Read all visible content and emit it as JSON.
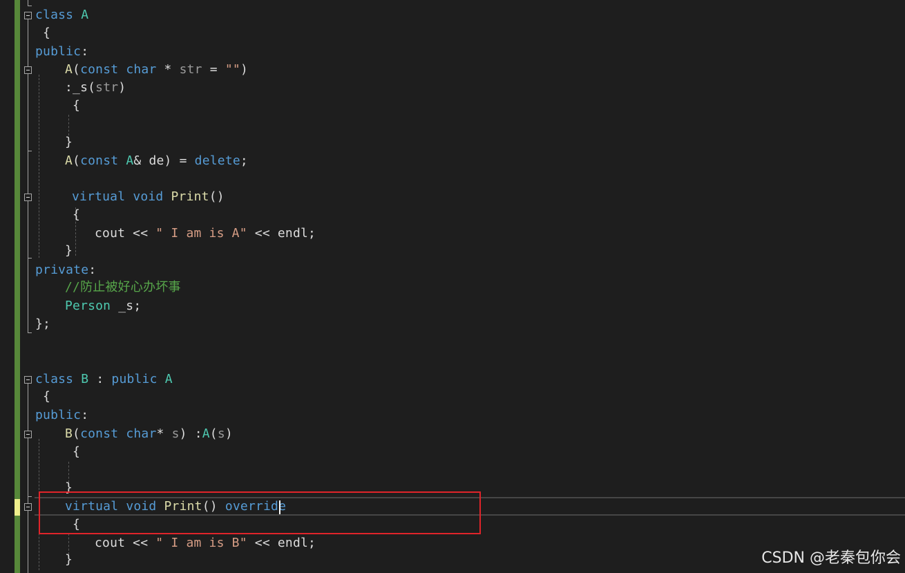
{
  "editor": {
    "lines": {
      "l01": {
        "kw": "class",
        "name": "A"
      },
      "l02": {
        "text": "{"
      },
      "l03": {
        "kw": "public",
        "colon": ":"
      },
      "l04": {
        "fn": "A",
        "p1": "(",
        "kw1": "const",
        "kw2": "char",
        "rest": " * ",
        "param": "str",
        "eq": " = ",
        "str": "\"\"",
        "p2": ")"
      },
      "l05": {
        "colon": ":",
        "member": "_s",
        "p1": "(",
        "param": "str",
        "p2": ")"
      },
      "l06": {
        "text": "{"
      },
      "l07": {
        "text": "}"
      },
      "l08": {
        "fn": "A",
        "p1": "(",
        "kw1": "const",
        "type": "A",
        "rest": "& de) = ",
        "kw2": "delete",
        "semi": ";"
      },
      "l09": {
        "kw1": "virtual",
        "kw2": "void",
        "fn": "Print",
        "parens": "()"
      },
      "l10": {
        "text": "{"
      },
      "l11": {
        "a": "cout << ",
        "str": "\" I am is A\"",
        "b": " << endl;"
      },
      "l12": {
        "text": "}"
      },
      "l13": {
        "kw": "private",
        "colon": ":"
      },
      "l14": {
        "comment": "//防止被好心办坏事"
      },
      "l15": {
        "type": "Person",
        "rest": " _s;"
      },
      "l16": {
        "text": "};"
      },
      "l17": {
        "kw1": "class",
        "name": "B",
        "sep": " : ",
        "kw2": "public",
        "base": "A"
      },
      "l18": {
        "text": "{"
      },
      "l19": {
        "kw": "public",
        "colon": ":"
      },
      "l20": {
        "fn": "B",
        "p1": "(",
        "kw1": "const",
        "kw2": "char",
        "star": "* ",
        "param": "s",
        "p2": ")",
        "init": " :",
        "base": "A",
        "p3": "(",
        "arg": "s",
        "p4": ")"
      },
      "l21": {
        "text": "{"
      },
      "l22": {
        "text": "}"
      },
      "l23": {
        "kw1": "virtual",
        "kw2": "void",
        "fn": "Print",
        "parens": "()",
        "kw3": "override"
      },
      "l24": {
        "text": "{"
      },
      "l25": {
        "a": "cout << ",
        "str": "\" I am is B\"",
        "b": " << endl;"
      },
      "l26": {
        "text": "}"
      }
    }
  },
  "watermark": "CSDN @老秦包你会",
  "colors": {
    "background": "#1e1e1e",
    "keyword": "#569cd6",
    "type": "#4ec9b0",
    "function": "#dcdcaa",
    "string": "#d69d85",
    "comment": "#57a64a",
    "saved_change_bar": "#57883a",
    "unsaved_change_bar": "#efef8c",
    "highlight_box": "#e0242a"
  }
}
